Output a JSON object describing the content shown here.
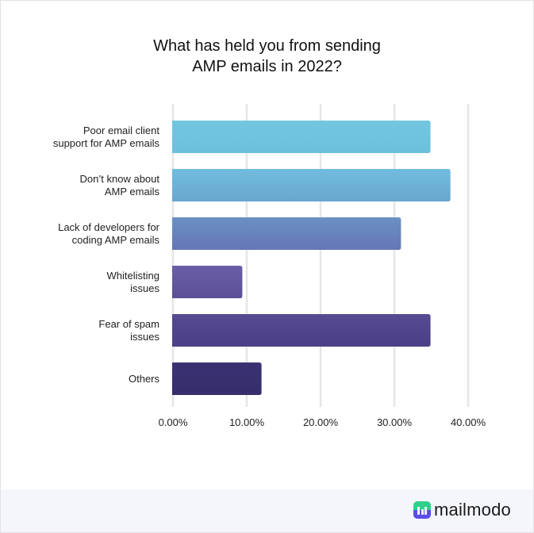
{
  "chart_data": {
    "type": "bar",
    "orientation": "horizontal",
    "title": "What has held you from sending AMP emails in 2022?",
    "title_lines": [
      "What has held you from sending",
      "AMP emails in 2022?"
    ],
    "categories": [
      [
        "Poor email client",
        "support for AMP emails"
      ],
      [
        "Don’t know about",
        "AMP emails"
      ],
      [
        "Lack of developers for",
        "coding AMP emails"
      ],
      [
        "Whitelisting",
        "issues"
      ],
      [
        "Fear of spam",
        "issues"
      ],
      [
        "Others"
      ]
    ],
    "values": [
      34.9,
      37.6,
      30.9,
      9.4,
      34.9,
      12.0
    ],
    "unit": "%",
    "xlim": [
      0,
      40
    ],
    "xticks": [
      0,
      10,
      20,
      30,
      40
    ],
    "xtick_labels": [
      "0.00%",
      "10.00%",
      "20.00%",
      "30.00%",
      "40.00%"
    ],
    "xlabel": "",
    "ylabel": "",
    "grid": true,
    "legend": "none",
    "colors": {
      "top": [
        "#72c6e0",
        "#70bdde",
        "#6b90c4",
        "#6a5ea7",
        "#564a93",
        "#3b3274"
      ],
      "bottom": [
        "#6cc0dc",
        "#6aa6cf",
        "#6576b6",
        "#5c4f98",
        "#4b3f86",
        "#352d6b"
      ]
    }
  },
  "footer": {
    "brand": "mailmodo"
  }
}
